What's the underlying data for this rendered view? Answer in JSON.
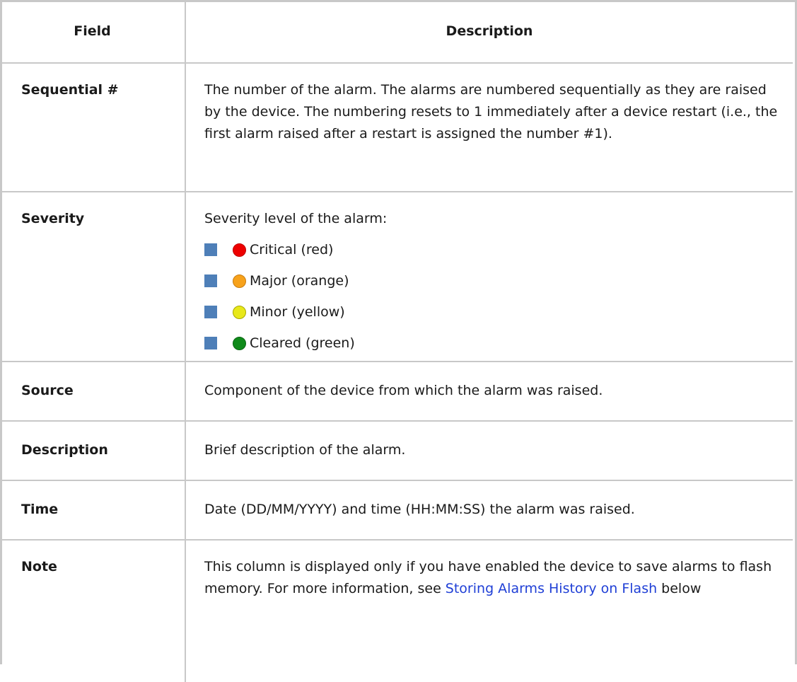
{
  "table": {
    "headers": {
      "field": "Field",
      "description": "Description"
    },
    "rows": {
      "sequential": {
        "field": "Sequential #",
        "description": "The number of the alarm. The alarms are numbered sequentially as they are raised by the device. The numbering resets to 1 immediately after a device restart (i.e., the first alarm raised after a restart is assigned the number #1)."
      },
      "severity": {
        "field": "Severity",
        "intro": "Severity level of the alarm:",
        "levels": [
          {
            "label": "Critical (red)",
            "color": "#ee0000",
            "border": "#c00000"
          },
          {
            "label": "Major (orange)",
            "color": "#f7a21b",
            "border": "#c87c10"
          },
          {
            "label": "Minor (yellow)",
            "color": "#e8e81a",
            "border": "#a8a800"
          },
          {
            "label": "Cleared (green)",
            "color": "#0f8a1a",
            "border": "#0a6512"
          }
        ]
      },
      "source": {
        "field": "Source",
        "description": "Component of the device from which the alarm was raised."
      },
      "description": {
        "field": "Description",
        "description": "Brief description of the alarm."
      },
      "time": {
        "field": "Time",
        "description": "Date (DD/MM/YYYY) and time (HH:MM:SS) the alarm was raised."
      },
      "note": {
        "field": "Note",
        "text_before": "This column is displayed only if you have enabled the device to save alarms to flash memory. For more information, see ",
        "link": "Storing Alarms History on Flash",
        "text_after": " below"
      }
    }
  },
  "colors": {
    "bullet": "#4e7fb8",
    "link": "#1f3fd6",
    "border": "#c8c8c8"
  }
}
